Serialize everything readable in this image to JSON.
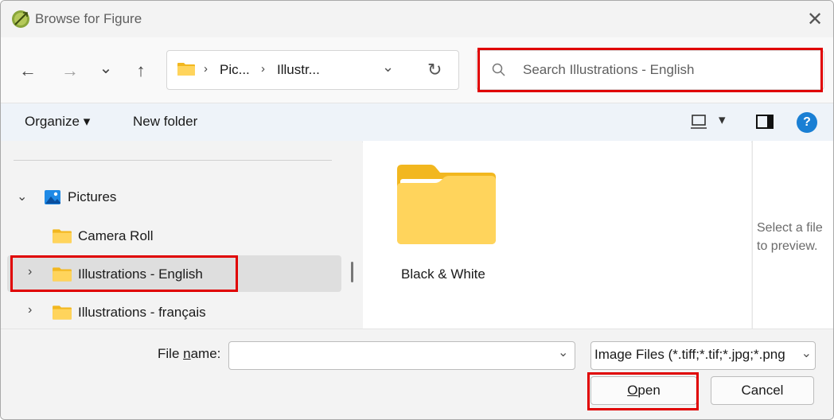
{
  "window": {
    "title": "Browse for Figure",
    "close_glyph": "✕"
  },
  "nav": {
    "back_glyph": "←",
    "forward_glyph": "→",
    "recent_glyph": "⌄",
    "up_glyph": "↑",
    "breadcrumbs": [
      "Pic...",
      "Illustr..."
    ],
    "crumb_separator": "›",
    "address_dropdown_glyph": "⌄",
    "refresh_glyph": "↻"
  },
  "search": {
    "placeholder": "Search Illustrations - English"
  },
  "toolbar": {
    "organize_label": "Organize ▾",
    "new_folder_label": "New folder",
    "view_dropdown_glyph": "▾",
    "help_glyph": "?"
  },
  "tree": {
    "items": [
      {
        "label": "Pictures",
        "chevron": "⌄",
        "icon": "pictures-icon",
        "expanded": true,
        "selected": false
      },
      {
        "label": "Camera Roll",
        "chevron": "",
        "icon": "folder-icon",
        "expanded": false,
        "selected": false
      },
      {
        "label": "Illustrations - English",
        "chevron": "›",
        "icon": "folder-icon",
        "expanded": false,
        "selected": true
      },
      {
        "label": "Illustrations - français",
        "chevron": "›",
        "icon": "folder-icon",
        "expanded": false,
        "selected": false
      }
    ]
  },
  "files": {
    "items": [
      {
        "label": "Black & White",
        "icon": "folder-icon"
      }
    ]
  },
  "preview": {
    "message": "Select a file to preview."
  },
  "bottom": {
    "file_name_label_prefix": "File ",
    "file_name_label_accel": "n",
    "file_name_label_suffix": "ame:",
    "file_name_value": "",
    "file_name_dropdown_glyph": "⌄",
    "file_type_value": "Image Files (*.tiff;*.tif;*.jpg;*.png",
    "file_type_dropdown_glyph": "⌄",
    "open_label_accel": "O",
    "open_label_rest": "pen",
    "cancel_label": "Cancel"
  },
  "colors": {
    "highlight_box": "#e00000",
    "accent": "#0067c0",
    "folder_yellow": "#f8c842",
    "folder_yellow_light": "#ffd96a"
  }
}
